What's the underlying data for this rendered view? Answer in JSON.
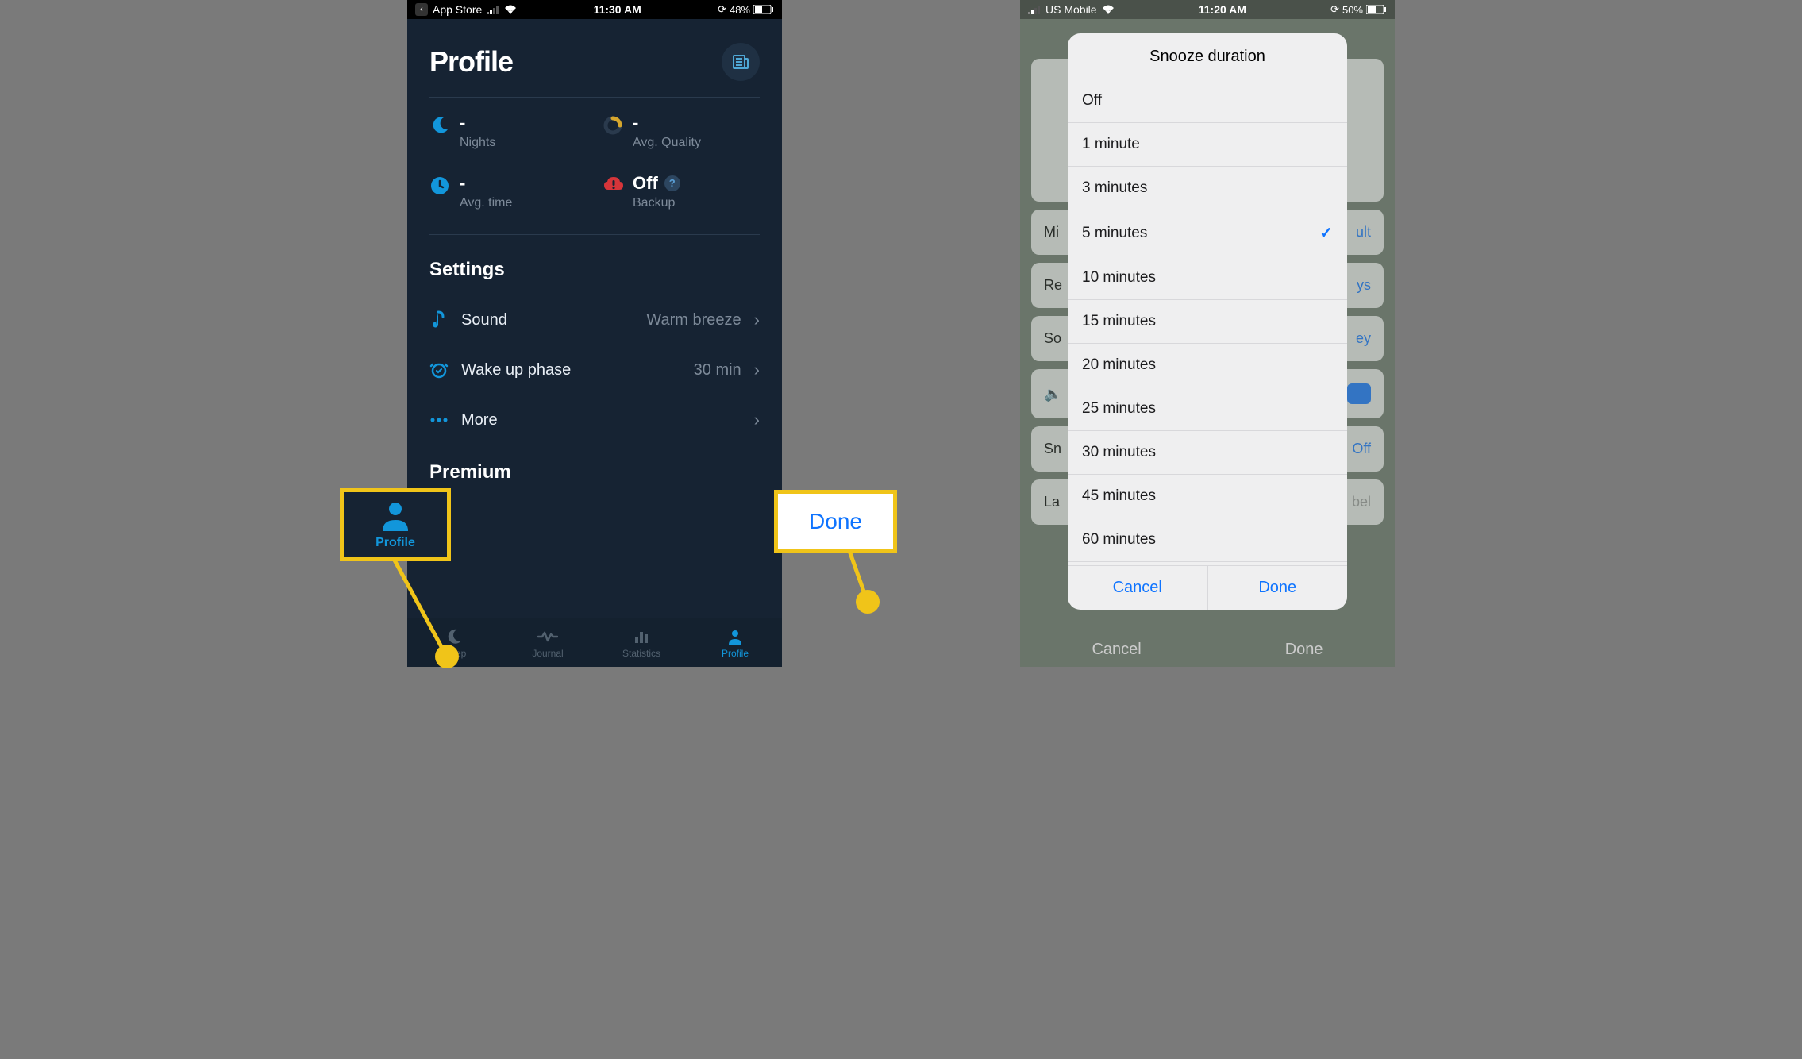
{
  "left": {
    "status": {
      "back_label": "App Store",
      "time": "11:30 AM",
      "battery": "48%"
    },
    "profile_title": "Profile",
    "stats": {
      "nights": {
        "value": "-",
        "label": "Nights"
      },
      "avg_quality": {
        "value": "-",
        "label": "Avg. Quality"
      },
      "avg_time": {
        "value": "-",
        "label": "Avg. time"
      },
      "backup": {
        "value": "Off",
        "label": "Backup",
        "help": "?"
      }
    },
    "sections": {
      "settings_title": "Settings",
      "premium_title": "Premium"
    },
    "settings": {
      "sound": {
        "label": "Sound",
        "value": "Warm breeze"
      },
      "wakeup": {
        "label": "Wake up phase",
        "value": "30 min"
      },
      "more": {
        "label": "More",
        "value": ""
      }
    },
    "tabs": {
      "sleep": "Sleep",
      "journal": "Journal",
      "statistics": "Statistics",
      "profile": "Profile"
    },
    "callout_label": "Profile"
  },
  "right": {
    "status": {
      "carrier": "US Mobile",
      "time": "11:20 AM",
      "battery": "50%"
    },
    "bg_rows": [
      {
        "l": "Mi",
        "v": "ult"
      },
      {
        "l": "Re",
        "v": "ys"
      },
      {
        "l": "So",
        "v": "ey"
      },
      {
        "l": "",
        "v": ""
      },
      {
        "l": "Sn",
        "v": "Off"
      },
      {
        "l": "La",
        "v": "bel"
      }
    ],
    "bg_actions": {
      "cancel": "Cancel",
      "done": "Done"
    },
    "dialog": {
      "title": "Snooze duration",
      "items": [
        {
          "label": "Off",
          "selected": false
        },
        {
          "label": "1 minute",
          "selected": false
        },
        {
          "label": "3 minutes",
          "selected": false
        },
        {
          "label": "5 minutes",
          "selected": true
        },
        {
          "label": "10 minutes",
          "selected": false
        },
        {
          "label": "15 minutes",
          "selected": false
        },
        {
          "label": "20 minutes",
          "selected": false
        },
        {
          "label": "25 minutes",
          "selected": false
        },
        {
          "label": "30 minutes",
          "selected": false
        },
        {
          "label": "45 minutes",
          "selected": false
        },
        {
          "label": "60 minutes",
          "selected": false
        }
      ],
      "cancel": "Cancel",
      "done": "Done"
    },
    "callout_label": "Done"
  }
}
